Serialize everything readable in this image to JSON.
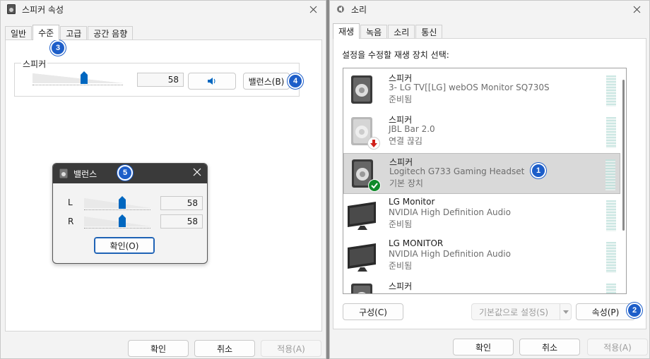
{
  "left_window": {
    "title": "스피커 속성",
    "tabs": [
      "일반",
      "수준",
      "고급",
      "공간 음향"
    ],
    "active_tab": "수준",
    "group_label": "스피커",
    "level_value": "58",
    "level_fraction": 0.58,
    "balance_button": "밸런스(B)",
    "buttons": {
      "ok": "확인",
      "cancel": "취소",
      "apply": "적용(A)"
    }
  },
  "balance_dialog": {
    "title": "밸런스",
    "channels": [
      {
        "label": "L",
        "value": "58",
        "fraction": 0.58
      },
      {
        "label": "R",
        "value": "58",
        "fraction": 0.58
      }
    ],
    "ok": "확인(O)"
  },
  "right_window": {
    "title": "소리",
    "tabs": [
      "재생",
      "녹음",
      "소리",
      "통신"
    ],
    "active_tab": "재생",
    "instruction": "설정을 수정할 재생 장치 선택:",
    "devices": [
      {
        "name": "스피커",
        "desc": "3- LG TV[[LG] webOS Monitor SQ730S",
        "status": "준비됨",
        "icon": "speaker-icon",
        "state": "normal"
      },
      {
        "name": "스피커",
        "desc": "JBL Bar 2.0",
        "status": "연결 끊김",
        "icon": "speaker-icon",
        "state": "disconnected"
      },
      {
        "name": "스피커",
        "desc": "Logitech G733 Gaming Headset",
        "status": "기본 장치",
        "icon": "speaker-icon",
        "state": "default"
      },
      {
        "name": "LG Monitor",
        "desc": "NVIDIA High Definition Audio",
        "status": "준비됨",
        "icon": "monitor-icon",
        "state": "normal"
      },
      {
        "name": "LG MONITOR",
        "desc": "NVIDIA High Definition Audio",
        "status": "준비됨",
        "icon": "monitor-icon",
        "state": "normal"
      },
      {
        "name": "스피커",
        "desc": "",
        "status": "",
        "icon": "speaker-icon",
        "state": "normal"
      }
    ],
    "configure": "구성(C)",
    "set_default": "기본값으로 설정(S)",
    "properties": "속성(P)",
    "buttons": {
      "ok": "확인",
      "cancel": "취소",
      "apply": "적용(A)"
    }
  },
  "badges": [
    "1",
    "2",
    "3",
    "4",
    "5"
  ],
  "colors": {
    "accent": "#0067c0",
    "badge": "#1d5ec9",
    "check": "#0f8a2a",
    "disconnect": "#d0211b"
  }
}
